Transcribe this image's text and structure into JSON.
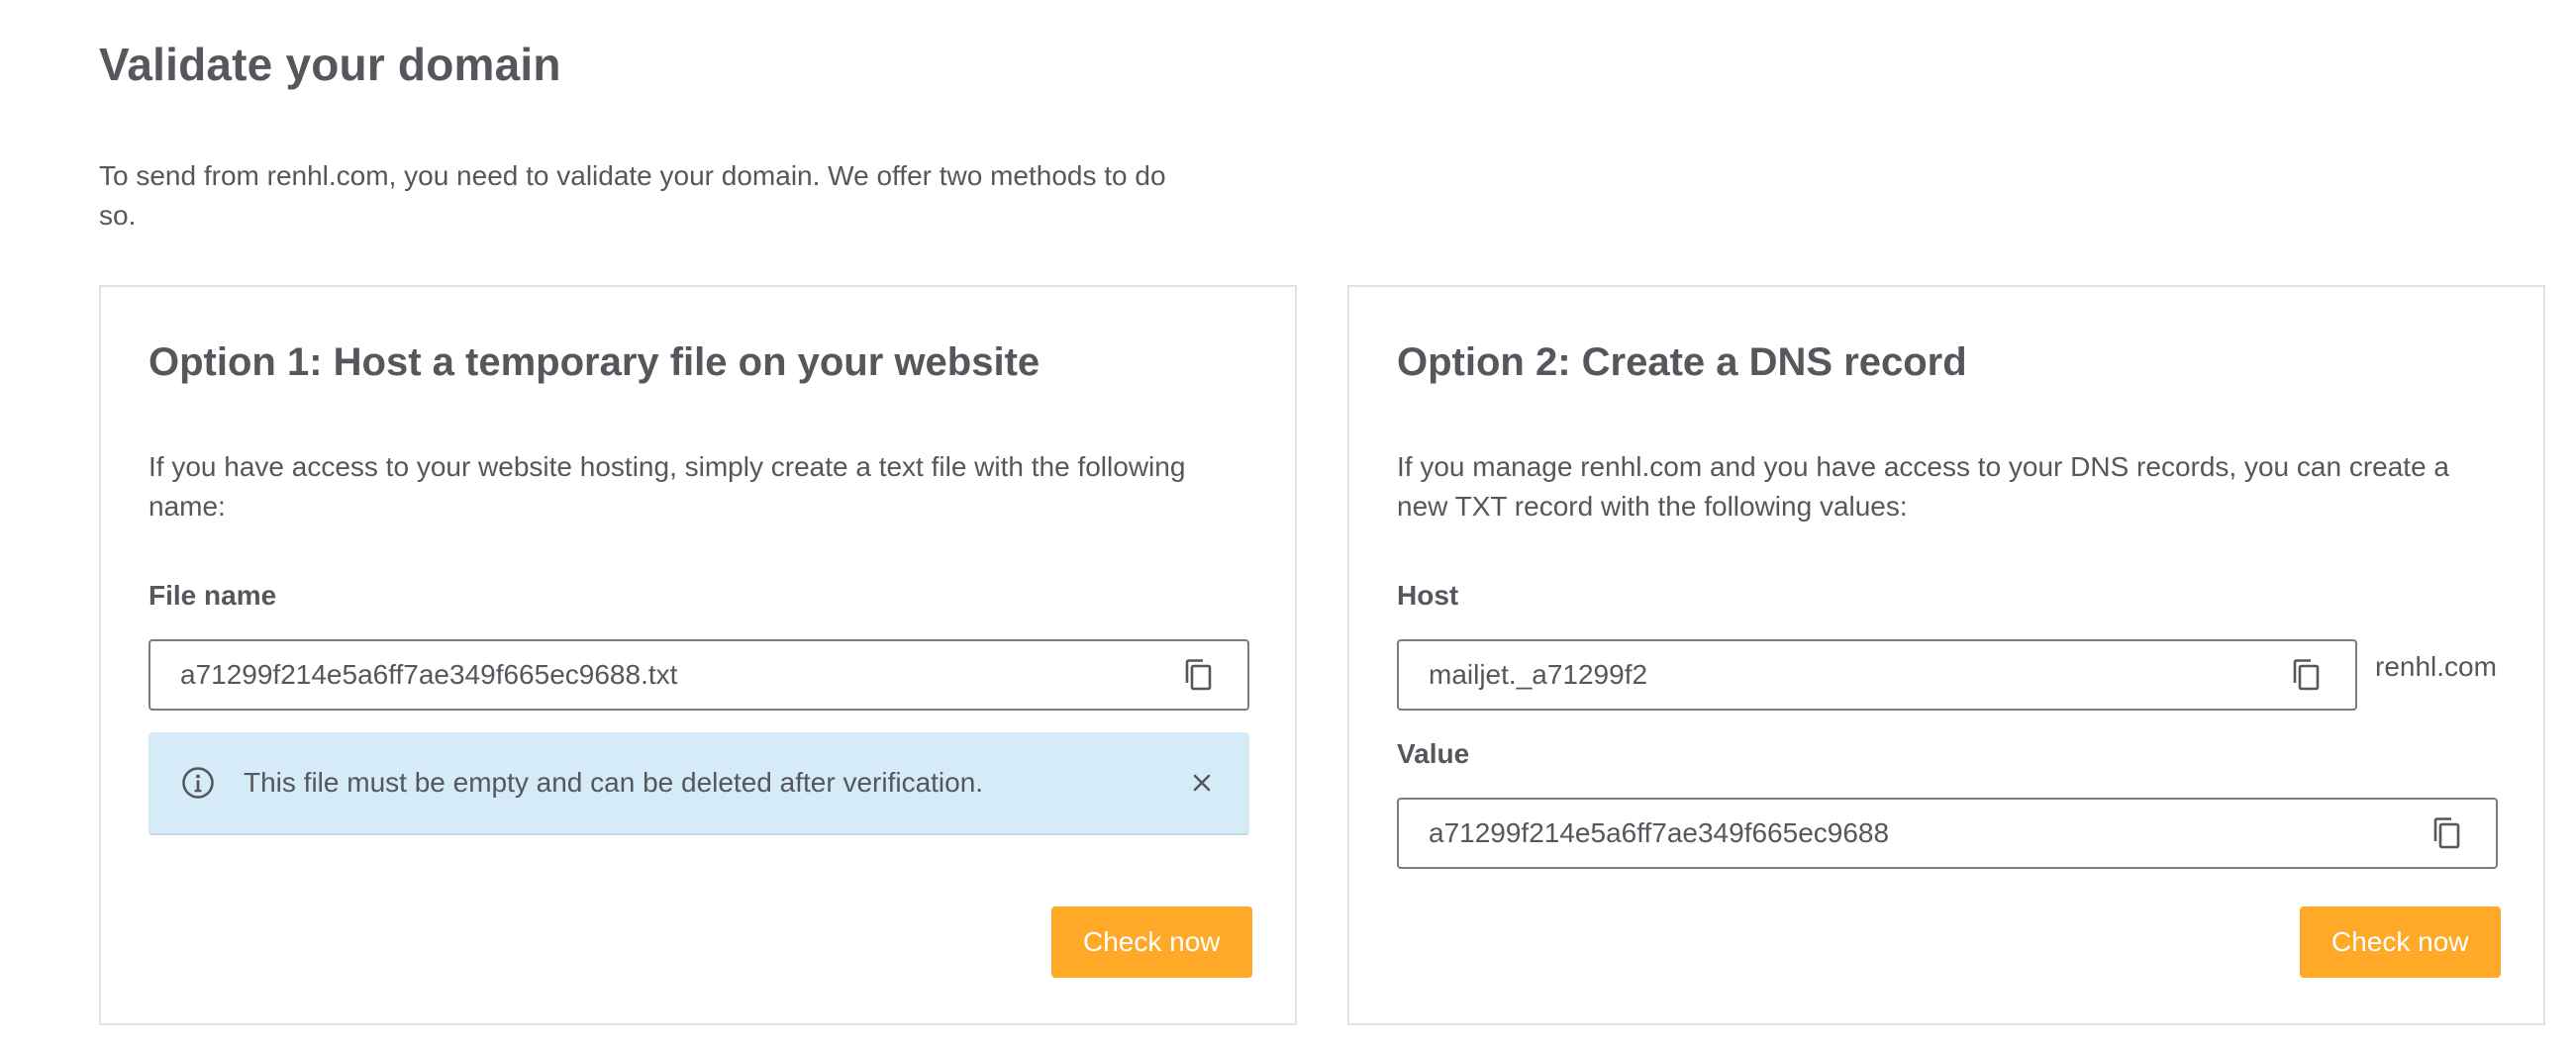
{
  "page": {
    "title": "Validate your domain",
    "intro": "To send from renhl.com, you need to validate your domain. We offer two methods to do so."
  },
  "option1": {
    "title": "Option 1: Host a temporary file on your website",
    "description": "If you have access to your website hosting, simply create a text file with the following name:",
    "file_label": "File name",
    "file_value": "a71299f214e5a6ff7ae349f665ec9688.txt",
    "alert_text": "This file must be empty and can be deleted after verification.",
    "check_label": "Check now"
  },
  "option2": {
    "title": "Option 2: Create a DNS record",
    "description": "If you manage renhl.com and you have access to your DNS records, you can create a new TXT record with the following values:",
    "host_label": "Host",
    "host_value": "mailjet._a71299f2",
    "host_suffix": "renhl.com",
    "value_label": "Value",
    "value_value": "a71299f214e5a6ff7ae349f665ec9688",
    "check_label": "Check now"
  },
  "icons": {
    "copy": "copy-icon",
    "info": "info-icon",
    "close": "close-icon"
  },
  "colors": {
    "text": "#55575d",
    "accent": "#fea928",
    "alert_bg": "#d5ebf7",
    "border": "#e1e2e5"
  }
}
